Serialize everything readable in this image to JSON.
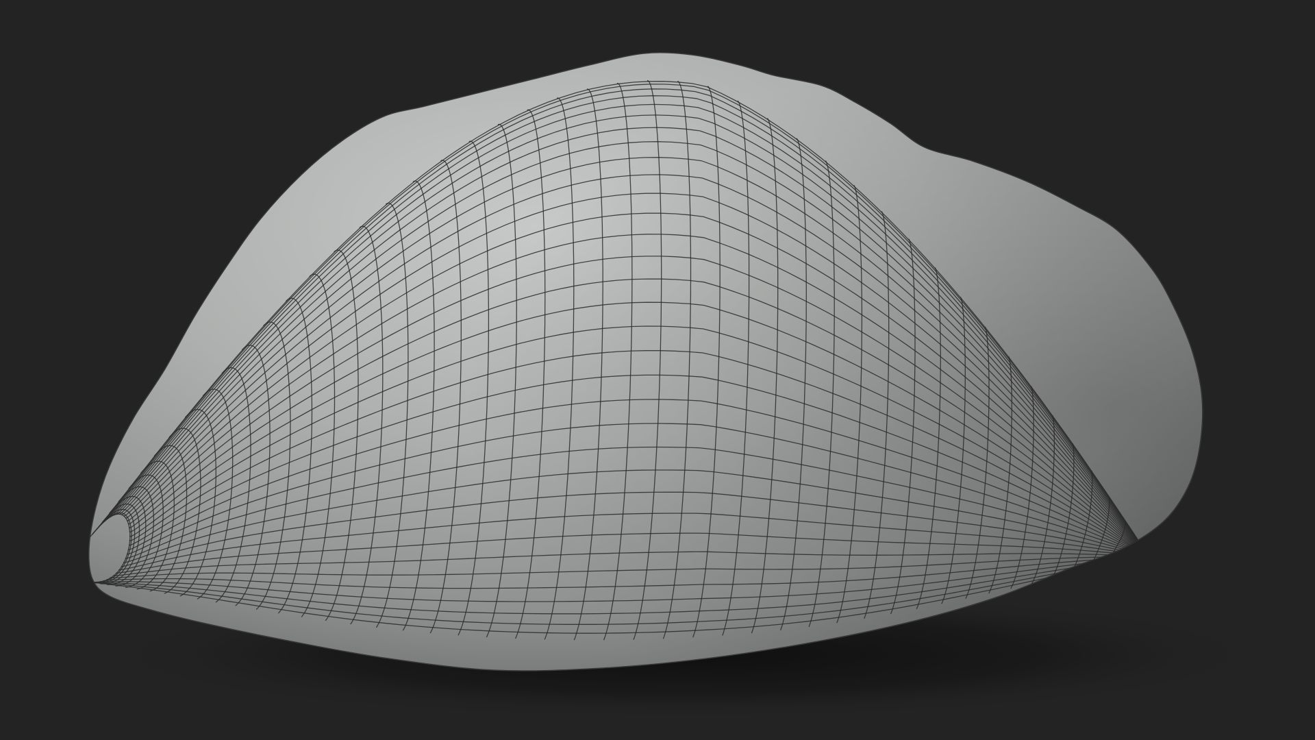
{
  "scene": {
    "background_color": "#232323",
    "object": {
      "kind": "wireframe-mesh",
      "shading": "clay-gray",
      "surface_color": "#a8aaa9",
      "highlight_color": "#c9cbca",
      "shadow_color": "#6e706f",
      "wire_color": "#2a2a2a",
      "ground_shadow": true
    }
  }
}
